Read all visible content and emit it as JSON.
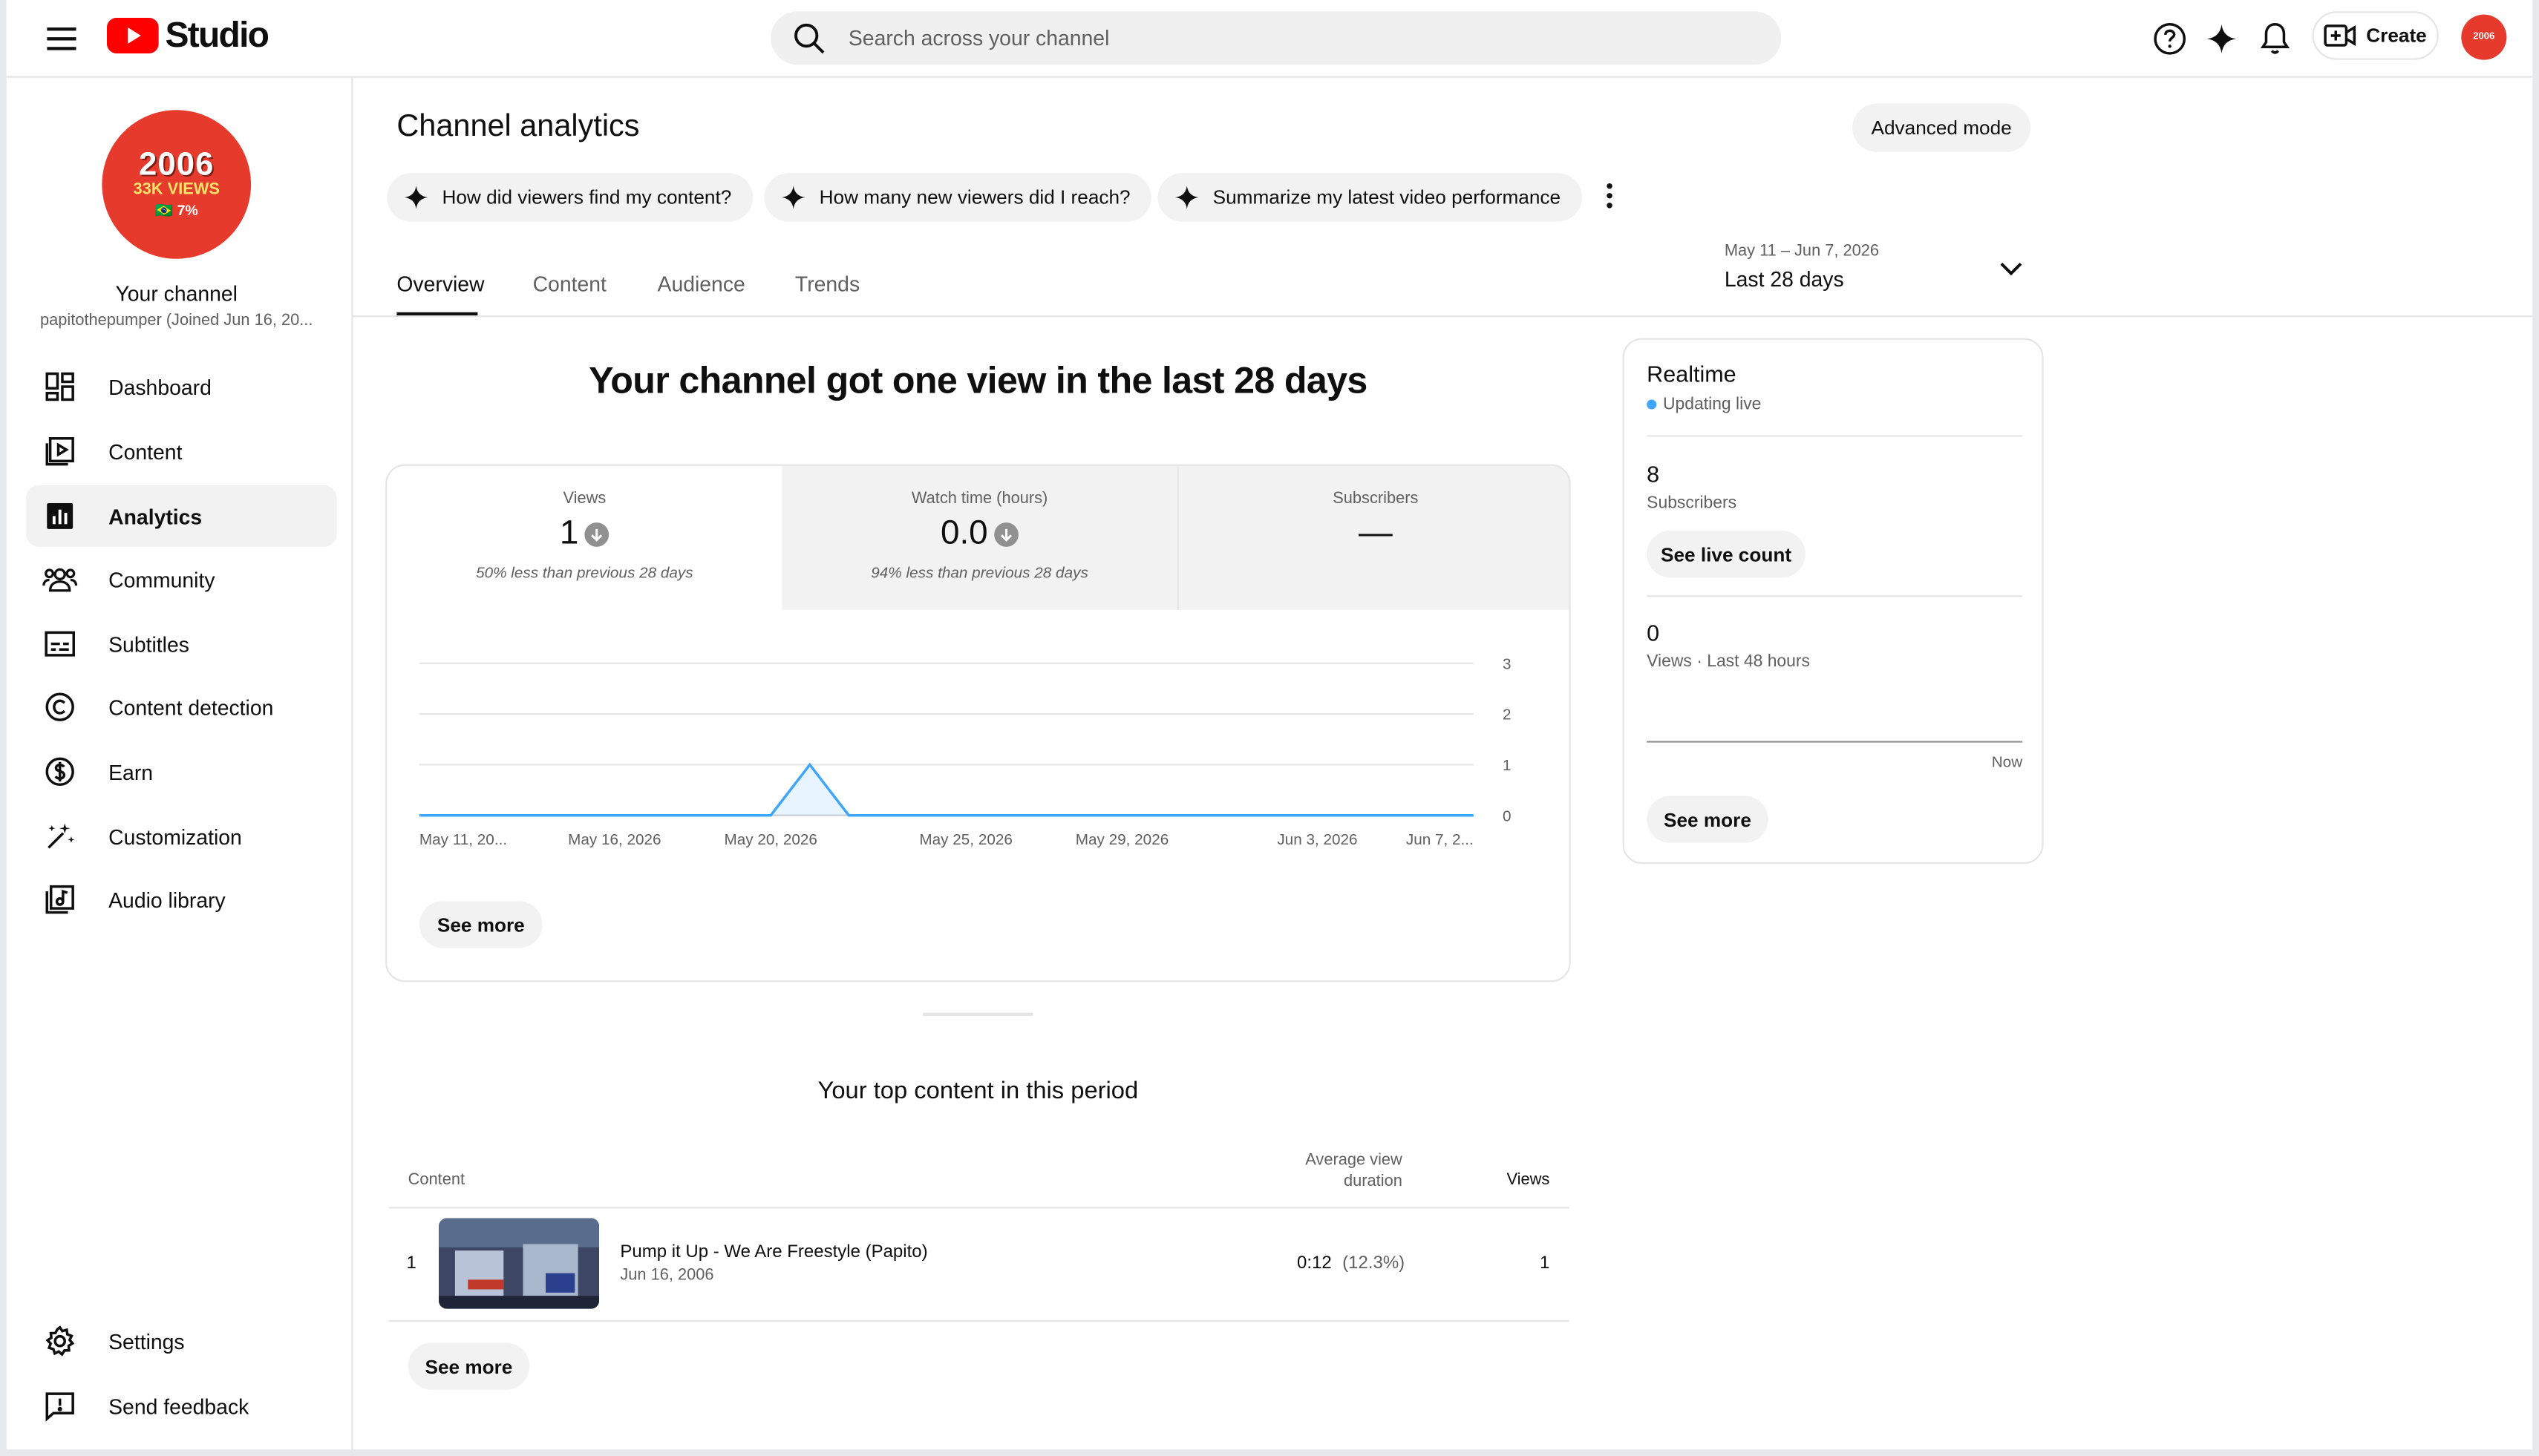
{
  "app": {
    "logo_text": "Studio",
    "brand_color": "#ff0000",
    "accent_color": "#065fd4"
  },
  "header": {
    "search_placeholder": "Search across your channel",
    "create_label": "Create",
    "avatar_text": "2006"
  },
  "sidebar": {
    "avatar": {
      "line1": "2006",
      "line2": "33K VIEWS",
      "line3": "🇧🇷 7%"
    },
    "channel_title": "Your channel",
    "channel_sub": "papitothepumper (Joined Jun 16, 20...",
    "items": [
      {
        "label": "Dashboard",
        "icon": "dashboard-icon"
      },
      {
        "label": "Content",
        "icon": "content-icon"
      },
      {
        "label": "Analytics",
        "icon": "analytics-icon",
        "active": true
      },
      {
        "label": "Community",
        "icon": "community-icon"
      },
      {
        "label": "Subtitles",
        "icon": "subtitles-icon"
      },
      {
        "label": "Content detection",
        "icon": "copyright-icon"
      },
      {
        "label": "Earn",
        "icon": "dollar-icon"
      },
      {
        "label": "Customization",
        "icon": "magic-wand-icon"
      },
      {
        "label": "Audio library",
        "icon": "audio-library-icon"
      }
    ],
    "bottom_items": [
      {
        "label": "Settings",
        "icon": "gear-icon"
      },
      {
        "label": "Send feedback",
        "icon": "feedback-icon"
      }
    ]
  },
  "main": {
    "title": "Channel analytics",
    "advanced_mode": "Advanced mode",
    "chips": [
      "How did viewers find my content?",
      "How many new viewers did I reach?",
      "Summarize my latest video performance"
    ],
    "tabs": [
      "Overview",
      "Content",
      "Audience",
      "Trends"
    ],
    "active_tab": "Overview",
    "date_range": "May 11 – Jun 7, 2026",
    "date_label": "Last 28 days",
    "headline": "Your channel got one view in the last 28 days",
    "metrics": [
      {
        "label": "Views",
        "value": "1",
        "note": "50% less than previous 28 days",
        "trend": "down"
      },
      {
        "label": "Watch time (hours)",
        "value": "0.0",
        "note": "94% less than previous 28 days",
        "trend": "down"
      },
      {
        "label": "Subscribers",
        "value": "—",
        "note": ""
      }
    ],
    "see_more": "See more",
    "top_content": {
      "title": "Your top content in this period",
      "col_content": "Content",
      "col_avd_line1": "Average view",
      "col_avd_line2": "duration",
      "col_views": "Views",
      "rows": [
        {
          "rank": "1",
          "title": "Pump it Up - We Are Freestyle (Papito)",
          "date": "Jun 16, 2006",
          "avd": "0:12",
          "avd_pct": "(12.3%)",
          "views": "1"
        }
      ],
      "see_more": "See more"
    }
  },
  "realtime": {
    "title": "Realtime",
    "status": "Updating live",
    "subscribers_value": "8",
    "subscribers_label": "Subscribers",
    "see_live_count": "See live count",
    "views_value": "0",
    "views_label": "Views · Last 48 hours",
    "now_label": "Now",
    "see_more": "See more"
  },
  "chart_data": {
    "type": "line",
    "title": "",
    "xlabel": "",
    "ylabel": "",
    "ylim": [
      0,
      3
    ],
    "y_ticks": [
      "3",
      "2",
      "1",
      "0"
    ],
    "x_tick_labels": [
      "May 11, 20...",
      "May 16, 2026",
      "May 20, 2026",
      "May 25, 2026",
      "May 29, 2026",
      "Jun 3, 2026",
      "Jun 7, 2..."
    ],
    "x": [
      "May 11",
      "May 12",
      "May 13",
      "May 14",
      "May 15",
      "May 16",
      "May 17",
      "May 18",
      "May 19",
      "May 20",
      "May 21",
      "May 22",
      "May 23",
      "May 24",
      "May 25",
      "May 26",
      "May 27",
      "May 28",
      "May 29",
      "May 30",
      "May 31",
      "Jun 1",
      "Jun 2",
      "Jun 3",
      "Jun 4",
      "Jun 5",
      "Jun 6",
      "Jun 7"
    ],
    "series": [
      {
        "values": [
          0,
          0,
          0,
          0,
          0,
          0,
          0,
          0,
          0,
          0,
          1,
          0,
          0,
          0,
          0,
          0,
          0,
          0,
          0,
          0,
          0,
          0,
          0,
          0,
          0,
          0,
          0,
          0
        ]
      }
    ],
    "grid": true,
    "line_color": "#3ea6ff"
  }
}
